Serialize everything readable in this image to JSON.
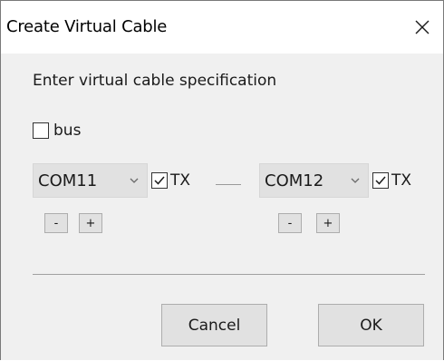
{
  "window": {
    "title": "Create Virtual Cable"
  },
  "dialog": {
    "instruction": "Enter virtual cable specification",
    "bus": {
      "label": "bus",
      "checked": false
    },
    "left": {
      "port": "COM11",
      "tx_label": "TX",
      "tx_checked": true,
      "minus_label": "-",
      "plus_label": "+"
    },
    "right": {
      "port": "COM12",
      "tx_label": "TX",
      "tx_checked": true,
      "minus_label": "-",
      "plus_label": "+"
    },
    "cancel_label": "Cancel",
    "ok_label": "OK"
  },
  "icons": {
    "close": "close-icon",
    "dropdown": "chevron-down-icon",
    "check": "checkmark-icon"
  },
  "colors": {
    "dialog_bg": "#f0f0f0",
    "title_bg": "#ffffff",
    "button_bg": "#e1e1e1",
    "button_border": "#adadad"
  }
}
